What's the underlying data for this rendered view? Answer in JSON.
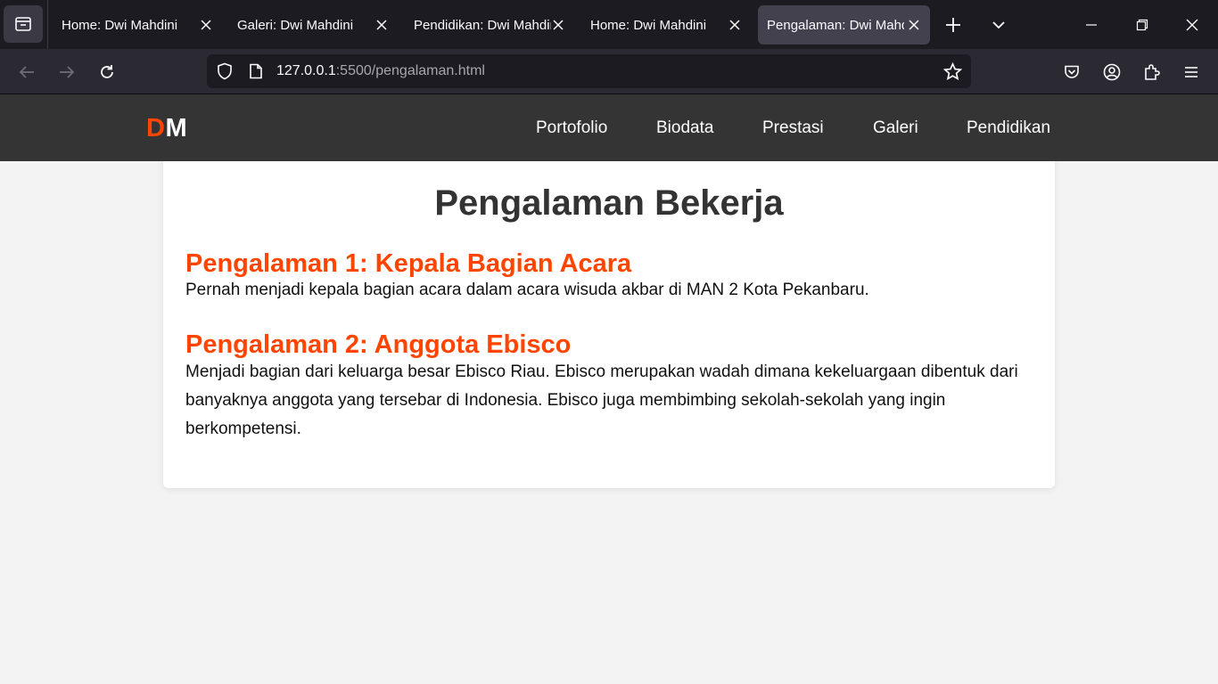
{
  "browser": {
    "tabs": [
      {
        "title": "Home: Dwi Mahdini",
        "active": false
      },
      {
        "title": "Galeri: Dwi Mahdini",
        "active": false
      },
      {
        "title": "Pendidikan: Dwi Mahdini",
        "active": false
      },
      {
        "title": "Home: Dwi Mahdini",
        "active": false
      },
      {
        "title": "Pengalaman: Dwi Mahdini",
        "active": true
      }
    ],
    "url": {
      "host": "127.0.0.1",
      "rest": ":5500/pengalaman.html"
    }
  },
  "site": {
    "brand": {
      "first": "D",
      "second": "M"
    },
    "nav": [
      "Portofolio",
      "Biodata",
      "Prestasi",
      "Galeri",
      "Pendidikan"
    ],
    "page_title": "Pengalaman Bekerja",
    "experiences": [
      {
        "title": "Pengalaman 1: Kepala Bagian Acara",
        "description": "Pernah menjadi kepala bagian acara dalam acara wisuda akbar di MAN 2 Kota Pekanbaru."
      },
      {
        "title": "Pengalaman 2: Anggota Ebisco",
        "description": "Menjadi bagian dari keluarga besar Ebisco Riau. Ebisco merupakan wadah dimana kekeluargaan dibentuk dari banyaknya anggota yang tersebar di Indonesia. Ebisco juga membimbing sekolah-sekolah yang ingin berkompetensi."
      }
    ]
  },
  "colors": {
    "accent": "#ff4500",
    "header_bg": "#2d2d2d",
    "page_bg": "#f3f3f3",
    "card_bg": "#ffffff",
    "title_text": "#333333"
  },
  "icons": {
    "tab_list": "tab-list-icon",
    "close": "close-icon",
    "new_tab": "plus-icon",
    "tab_overflow": "chevron-down-icon",
    "back": "back-arrow-icon",
    "forward": "forward-arrow-icon",
    "reload": "reload-icon",
    "tracking": "shield-icon",
    "page": "page-icon",
    "bookmark": "star-icon",
    "pocket": "pocket-icon",
    "account": "account-icon",
    "extensions": "puzzle-icon",
    "menu": "hamburger-menu-icon"
  }
}
